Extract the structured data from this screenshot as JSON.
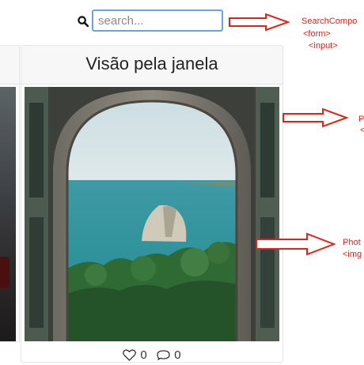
{
  "search": {
    "placeholder": "search..."
  },
  "post": {
    "title": "Visão pela janela",
    "likes": "0",
    "comments": "0"
  },
  "annotations": {
    "search_label": "SearchCompo",
    "search_form": "<form>",
    "search_input": "<input>",
    "post_label": "P",
    "post_tag": "<",
    "photo_label": "Phot",
    "photo_tag": "<img"
  },
  "colors": {
    "annotation": "#e0241b",
    "input_border": "#6aa3e0"
  }
}
